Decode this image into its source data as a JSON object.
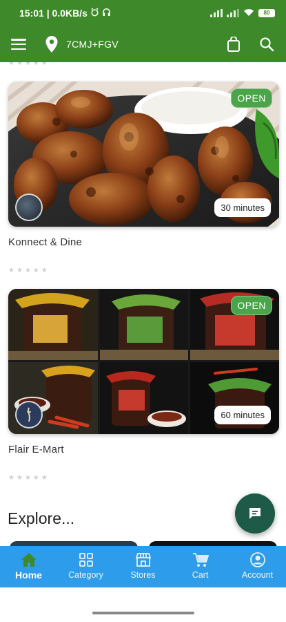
{
  "status_bar": {
    "time_speed": "15:01 | 0.0KB/s",
    "battery": "80"
  },
  "app_bar": {
    "location": "7CMJ+FGV"
  },
  "stores": [
    {
      "name": "Konnect & Dine",
      "status": "OPEN",
      "delivery_time": "30 minutes",
      "rating_stars": 5
    },
    {
      "name": "Flair E-Mart",
      "status": "OPEN",
      "delivery_time": "60 minutes",
      "rating_stars": 5
    }
  ],
  "explore_title": "Explore...",
  "bottom_nav": [
    {
      "label": "Home",
      "icon": "home-icon",
      "active": true
    },
    {
      "label": "Category",
      "icon": "grid-icon",
      "active": false
    },
    {
      "label": "Stores",
      "icon": "store-icon",
      "active": false
    },
    {
      "label": "Cart",
      "icon": "cart-icon",
      "active": false
    },
    {
      "label": "Account",
      "icon": "account-icon",
      "active": false
    }
  ],
  "colors": {
    "app_bar": "#3e8a2b",
    "open_badge": "#4aa54a",
    "bottom_nav": "#2d9cea",
    "fab": "#1d5a48"
  }
}
